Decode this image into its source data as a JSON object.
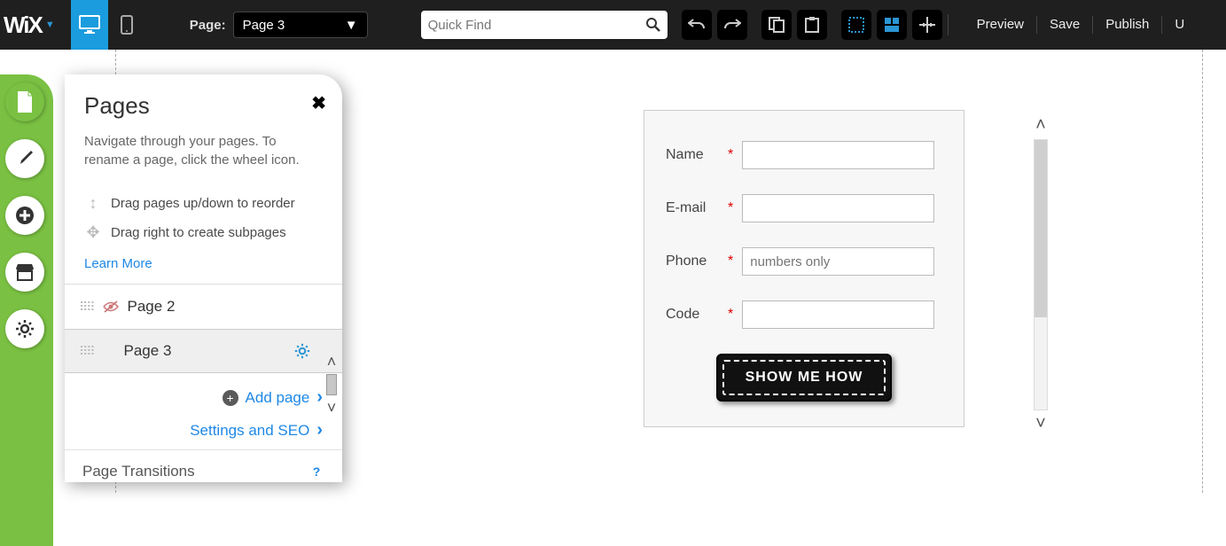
{
  "topbar": {
    "logo": "WiX",
    "page_label": "Page:",
    "page_select": "Page 3",
    "quickfind_placeholder": "Quick Find",
    "links": {
      "preview": "Preview",
      "save": "Save",
      "publish": "Publish",
      "upgrade": "U"
    }
  },
  "panel": {
    "title": "Pages",
    "desc": "Navigate through your pages. To rename a page, click the wheel icon.",
    "hint_reorder": "Drag pages up/down to reorder",
    "hint_subpage": "Drag right to create subpages",
    "learn_more": "Learn More",
    "pages": [
      {
        "name": "Page 2",
        "hidden": true,
        "selected": false
      },
      {
        "name": "Page 3",
        "hidden": false,
        "selected": true
      }
    ],
    "add_page": "Add page",
    "seo": "Settings and SEO",
    "transitions": "Page Transitions"
  },
  "form": {
    "fields": {
      "name": "Name",
      "email": "E-mail",
      "phone": "Phone",
      "code": "Code"
    },
    "phone_placeholder": "numbers only",
    "submit": "SHOW ME HOW"
  }
}
